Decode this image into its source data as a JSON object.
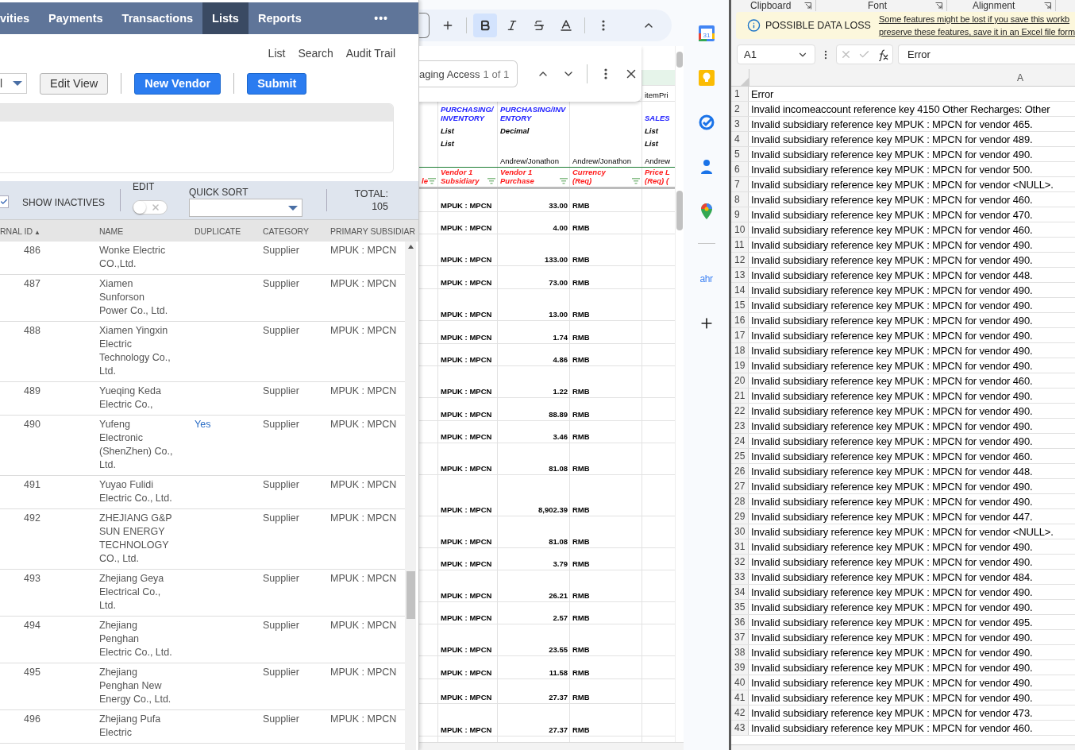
{
  "vendor_list": {
    "nav_tabs": [
      {
        "label": "vities",
        "selected": false
      },
      {
        "label": "Payments",
        "selected": false
      },
      {
        "label": "Transactions",
        "selected": false
      },
      {
        "label": "Lists",
        "selected": true
      },
      {
        "label": "Reports",
        "selected": false
      }
    ],
    "nav_more": "•••",
    "header_links": [
      "List",
      "Search",
      "Audit Trail"
    ],
    "view_select": "l",
    "buttons": [
      {
        "label": "Edit View",
        "kind": "secondary"
      },
      {
        "label": "New Vendor",
        "kind": "primary"
      },
      {
        "label": "Submit",
        "kind": "primary"
      }
    ],
    "filters": {
      "show_inactives": {
        "label": "SHOW INACTIVES",
        "checked": true
      },
      "edit": {
        "label": "EDIT",
        "on": false
      },
      "quick_sort": {
        "label": "QUICK SORT"
      },
      "total_label": "TOTAL:",
      "total": "105"
    },
    "table": {
      "columns": [
        {
          "label": "RNAL ID",
          "sort_icon": "▲"
        },
        {
          "label": "NAME"
        },
        {
          "label": "DUPLICATE"
        },
        {
          "label": "CATEGORY"
        },
        {
          "label": "PRIMARY SUBSIDIAR"
        }
      ],
      "rows": [
        {
          "id": "486",
          "name": "Wonke Electric\nCO.,Ltd.",
          "category": "Supplier",
          "subsidiary": "MPUK : MPCN"
        },
        {
          "id": "487",
          "name": "Xiamen\nSunforson\nPower Co., Ltd.",
          "category": "Supplier",
          "subsidiary": "MPUK : MPCN"
        },
        {
          "id": "488",
          "name": "Xiamen Yingxin\nElectric\nTechnology Co.,\nLtd.",
          "category": "Supplier",
          "subsidiary": "MPUK : MPCN"
        },
        {
          "id": "489",
          "name": "Yueqing Keda\nElectric Co.,",
          "category": "Supplier",
          "subsidiary": "MPUK : MPCN"
        },
        {
          "id": "490",
          "name": "Yufeng\nElectronic\n(ShenZhen) Co.,\nLtd.",
          "duplicate": "Yes",
          "category": "Supplier",
          "subsidiary": "MPUK : MPCN"
        },
        {
          "id": "491",
          "name": "Yuyao Fulidi\nElectric Co., Ltd.",
          "category": "Supplier",
          "subsidiary": "MPUK : MPCN"
        },
        {
          "id": "492",
          "name": "ZHEJIANG G&P\nSUN ENERGY\nTECHNOLOGY\nCO., Ltd.",
          "category": "Supplier",
          "subsidiary": "MPUK : MPCN"
        },
        {
          "id": "493",
          "name": "Zhejiang Geya\nElectrical Co.,\nLtd.",
          "category": "Supplier",
          "subsidiary": "MPUK : MPCN"
        },
        {
          "id": "494",
          "name": "Zhejiang\nPenghan\nElectric Co., Ltd.",
          "category": "Supplier",
          "subsidiary": "MPUK : MPCN"
        },
        {
          "id": "495",
          "name": "Zhejiang\nPenghan New\nEnergy Co., Ltd.",
          "category": "Supplier",
          "subsidiary": "MPUK : MPCN"
        },
        {
          "id": "496",
          "name": "Zhejiang Pufa\nElectric",
          "category": "Supplier",
          "subsidiary": "MPUK : MPCN"
        }
      ]
    }
  },
  "sheet": {
    "toolbar": [
      {
        "kind": "plus",
        "selected": false
      },
      {
        "kind": "bold",
        "selected": true
      },
      {
        "kind": "italic",
        "selected": false
      },
      {
        "kind": "strike",
        "selected": false
      },
      {
        "kind": "color",
        "selected": false
      },
      {
        "kind": "more",
        "selected": false
      },
      {
        "kind": "collapse",
        "selected": false
      }
    ],
    "find": {
      "value": "aging Access",
      "count": "1 of 1"
    },
    "top_cell": "itemPri",
    "header_rows": [
      {
        "kind": "category",
        "cells": [
          "",
          "PURCHASING/INVENTORY",
          "PURCHASING/INVENTORY",
          "",
          "SALES"
        ]
      },
      {
        "kind": "type",
        "cells": [
          "",
          "List",
          "Decimal",
          "",
          "List"
        ]
      },
      {
        "kind": "type",
        "cells": [
          "",
          "List",
          "",
          "",
          "List"
        ]
      },
      {
        "kind": "owner",
        "cells": [
          "",
          "",
          "Andrew/Jonathon",
          "Andrew/Jonathon",
          "Andrew"
        ]
      },
      {
        "kind": "field",
        "cells": [
          "le",
          "Vendor 1\nSubsidiary",
          "Vendor 1\nPurchase",
          "Currency\n(Req)",
          "Price L\n(Req) ("
        ]
      }
    ],
    "rows": [
      {
        "subsidiary": "MPUK : MPCN",
        "price": "33.00",
        "currency": "RMB"
      },
      {
        "subsidiary": "MPUK : MPCN",
        "price": "4.00",
        "currency": "RMB"
      },
      {
        "subsidiary": "MPUK : MPCN",
        "price": "133.00",
        "currency": "RMB"
      },
      {
        "subsidiary": "MPUK : MPCN",
        "price": "73.00",
        "currency": "RMB"
      },
      {
        "subsidiary": "MPUK : MPCN",
        "price": "13.00",
        "currency": "RMB"
      },
      {
        "subsidiary": "MPUK : MPCN",
        "price": "1.74",
        "currency": "RMB"
      },
      {
        "subsidiary": "MPUK : MPCN",
        "price": "4.86",
        "currency": "RMB"
      },
      {
        "subsidiary": "MPUK : MPCN",
        "price": "1.22",
        "currency": "RMB"
      },
      {
        "subsidiary": "MPUK : MPCN",
        "price": "88.89",
        "currency": "RMB"
      },
      {
        "subsidiary": "MPUK : MPCN",
        "price": "3.46",
        "currency": "RMB"
      },
      {
        "subsidiary": "MPUK : MPCN",
        "price": "81.08",
        "currency": "RMB"
      },
      {
        "subsidiary": "MPUK : MPCN",
        "price": "8,902.39",
        "currency": "RMB"
      },
      {
        "subsidiary": "MPUK : MPCN",
        "price": "81.08",
        "currency": "RMB"
      },
      {
        "subsidiary": "MPUK : MPCN",
        "price": "3.79",
        "currency": "RMB"
      },
      {
        "subsidiary": "MPUK : MPCN",
        "price": "26.21",
        "currency": "RMB"
      },
      {
        "subsidiary": "MPUK : MPCN",
        "price": "2.57",
        "currency": "RMB"
      },
      {
        "subsidiary": "MPUK : MPCN",
        "price": "23.55",
        "currency": "RMB"
      },
      {
        "subsidiary": "MPUK : MPCN",
        "price": "11.58",
        "currency": "RMB"
      },
      {
        "subsidiary": "MPUK : MPCN",
        "price": "27.37",
        "currency": "RMB"
      },
      {
        "subsidiary": "MPUK : MPCN",
        "price": "27.37",
        "currency": "RMB"
      }
    ]
  },
  "side_panel": {
    "items": [
      {
        "kind": "calendar",
        "text": "31"
      },
      {
        "kind": "keep"
      },
      {
        "kind": "tasks"
      },
      {
        "kind": "contacts"
      },
      {
        "kind": "maps"
      },
      {
        "kind": "divider"
      },
      {
        "kind": "addon",
        "text": "ahr"
      },
      {
        "kind": "add"
      }
    ]
  },
  "excel": {
    "ribbon_groups": [
      "Clipboard",
      "Font",
      "Alignment"
    ],
    "message": {
      "title": "POSSIBLE DATA LOSS",
      "lines": [
        "Some features might be lost if you save this workb",
        "preserve these features, save it in an Excel file form"
      ]
    },
    "name_box": "A1",
    "formula": "Error",
    "column": "A",
    "rows": [
      {
        "n": "1",
        "text": "Error"
      },
      {
        "n": "2",
        "text": "Invalid incomeaccount reference key 4150 Other Recharges: Other"
      },
      {
        "n": "3",
        "text": "Invalid subsidiary reference key MPUK : MPCN for vendor 465."
      },
      {
        "n": "4",
        "text": "Invalid subsidiary reference key MPUK : MPCN for vendor 489."
      },
      {
        "n": "5",
        "text": "Invalid subsidiary reference key MPUK : MPCN for vendor 490."
      },
      {
        "n": "6",
        "text": "Invalid subsidiary reference key MPUK : MPCN for vendor 500."
      },
      {
        "n": "7",
        "text": "Invalid subsidiary reference key MPUK : MPCN for vendor <NULL>."
      },
      {
        "n": "8",
        "text": "Invalid subsidiary reference key MPUK : MPCN for vendor 460."
      },
      {
        "n": "9",
        "text": "Invalid subsidiary reference key MPUK : MPCN for vendor 470."
      },
      {
        "n": "10",
        "text": "Invalid subsidiary reference key MPUK : MPCN for vendor 460."
      },
      {
        "n": "11",
        "text": "Invalid subsidiary reference key MPUK : MPCN for vendor 490."
      },
      {
        "n": "12",
        "text": "Invalid subsidiary reference key MPUK : MPCN for vendor 490."
      },
      {
        "n": "13",
        "text": "Invalid subsidiary reference key MPUK : MPCN for vendor 448."
      },
      {
        "n": "14",
        "text": "Invalid subsidiary reference key MPUK : MPCN for vendor 490."
      },
      {
        "n": "15",
        "text": "Invalid subsidiary reference key MPUK : MPCN for vendor 490."
      },
      {
        "n": "16",
        "text": "Invalid subsidiary reference key MPUK : MPCN for vendor 490."
      },
      {
        "n": "17",
        "text": "Invalid subsidiary reference key MPUK : MPCN for vendor 490."
      },
      {
        "n": "18",
        "text": "Invalid subsidiary reference key MPUK : MPCN for vendor 490."
      },
      {
        "n": "19",
        "text": "Invalid subsidiary reference key MPUK : MPCN for vendor 490."
      },
      {
        "n": "20",
        "text": "Invalid subsidiary reference key MPUK : MPCN for vendor 460."
      },
      {
        "n": "21",
        "text": "Invalid subsidiary reference key MPUK : MPCN for vendor 490."
      },
      {
        "n": "22",
        "text": "Invalid subsidiary reference key MPUK : MPCN for vendor 490."
      },
      {
        "n": "23",
        "text": "Invalid subsidiary reference key MPUK : MPCN for vendor 490."
      },
      {
        "n": "24",
        "text": "Invalid subsidiary reference key MPUK : MPCN for vendor 490."
      },
      {
        "n": "25",
        "text": "Invalid subsidiary reference key MPUK : MPCN for vendor 460."
      },
      {
        "n": "26",
        "text": "Invalid subsidiary reference key MPUK : MPCN for vendor 448."
      },
      {
        "n": "27",
        "text": "Invalid subsidiary reference key MPUK : MPCN for vendor 490."
      },
      {
        "n": "28",
        "text": "Invalid subsidiary reference key MPUK : MPCN for vendor 490."
      },
      {
        "n": "29",
        "text": "Invalid subsidiary reference key MPUK : MPCN for vendor 447."
      },
      {
        "n": "30",
        "text": "Invalid subsidiary reference key MPUK : MPCN for vendor <NULL>."
      },
      {
        "n": "31",
        "text": "Invalid subsidiary reference key MPUK : MPCN for vendor 490."
      },
      {
        "n": "32",
        "text": "Invalid subsidiary reference key MPUK : MPCN for vendor 490."
      },
      {
        "n": "33",
        "text": "Invalid subsidiary reference key MPUK : MPCN for vendor 484."
      },
      {
        "n": "34",
        "text": "Invalid subsidiary reference key MPUK : MPCN for vendor 490."
      },
      {
        "n": "35",
        "text": "Invalid subsidiary reference key MPUK : MPCN for vendor 490."
      },
      {
        "n": "36",
        "text": "Invalid subsidiary reference key MPUK : MPCN for vendor 495."
      },
      {
        "n": "37",
        "text": "Invalid subsidiary reference key MPUK : MPCN for vendor 490."
      },
      {
        "n": "38",
        "text": "Invalid subsidiary reference key MPUK : MPCN for vendor 490."
      },
      {
        "n": "39",
        "text": "Invalid subsidiary reference key MPUK : MPCN for vendor 490."
      },
      {
        "n": "40",
        "text": "Invalid subsidiary reference key MPUK : MPCN for vendor 490."
      },
      {
        "n": "41",
        "text": "Invalid subsidiary reference key MPUK : MPCN for vendor 490."
      },
      {
        "n": "42",
        "text": "Invalid subsidiary reference key MPUK : MPCN for vendor 473."
      },
      {
        "n": "43",
        "text": "Invalid subsidiary reference key MPUK : MPCN for vendor 460."
      }
    ]
  }
}
